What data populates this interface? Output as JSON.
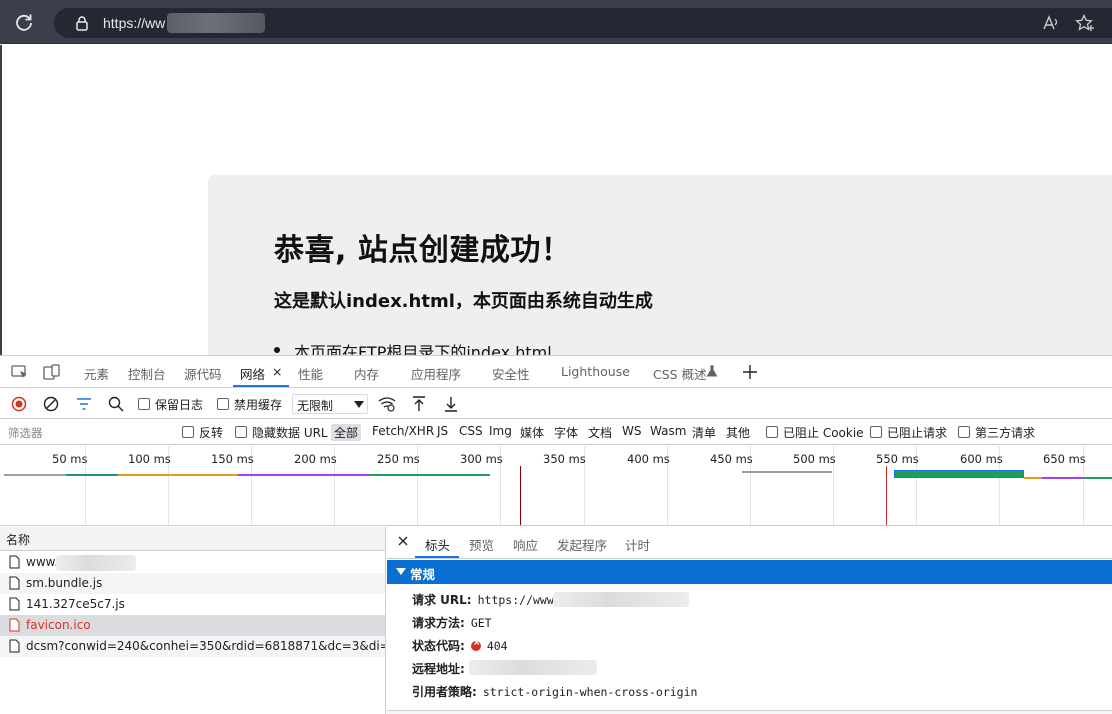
{
  "browser": {
    "url_prefix": "https://ww"
  },
  "page": {
    "title": "恭喜, 站点创建成功！",
    "subtitle": "这是默认index.html，本页面由系统自动生成",
    "bullets": [
      "本页面在FTP根目录下的index.html"
    ]
  },
  "devtools": {
    "tabs": [
      {
        "label": "元素"
      },
      {
        "label": "控制台"
      },
      {
        "label": "源代码"
      },
      {
        "label": "网络",
        "active": true
      },
      {
        "label": "性能"
      },
      {
        "label": "内存"
      },
      {
        "label": "应用程序"
      },
      {
        "label": "安全性"
      },
      {
        "label": "Lighthouse"
      },
      {
        "label": "CSS 概述"
      }
    ],
    "toolbar": {
      "preserve_log": "保留日志",
      "disable_cache": "禁用缓存",
      "throttle_value": "无限制"
    },
    "filter": {
      "placeholder": "筛选器",
      "invert": "反转",
      "hide_data_urls": "隐藏数据 URL",
      "types": [
        "全部",
        "Fetch/XHR",
        "JS",
        "CSS",
        "Img",
        "媒体",
        "字体",
        "文档",
        "WS",
        "Wasm",
        "清单",
        "其他"
      ],
      "blocked_cookies": "已阻止 Cookie",
      "blocked_requests": "已阻止请求",
      "third_party": "第三方请求"
    },
    "timeline": {
      "ticks": [
        "50 ms",
        "100 ms",
        "150 ms",
        "200 ms",
        "250 ms",
        "300 ms",
        "350 ms",
        "400 ms",
        "450 ms",
        "500 ms",
        "550 ms",
        "600 ms",
        "650 ms"
      ]
    },
    "requests": {
      "header": "名称",
      "rows": [
        {
          "name": "www.",
          "blurred": true
        },
        {
          "name": "sm.bundle.js"
        },
        {
          "name": "141.327ce5c7.js"
        },
        {
          "name": "favicon.ico",
          "error": true,
          "selected": true
        },
        {
          "name": "dcsm?conwid=240&conhei=350&rdid=6818871&dc=3&di=u681..."
        }
      ]
    },
    "detail": {
      "tabs": [
        "标头",
        "预览",
        "响应",
        "发起程序",
        "计时"
      ],
      "section_title": "常规",
      "fields": {
        "request_url_label": "请求 URL:",
        "request_url_value": "https://www.",
        "method_label": "请求方法:",
        "method_value": "GET",
        "status_label": "状态代码:",
        "status_value": "404",
        "remote_label": "远程地址:",
        "referrer_label": "引用者策略:",
        "referrer_value": "strict-origin-when-cross-origin"
      }
    }
  },
  "colors": {
    "accent": "#1a73e8",
    "section_blue": "#0a6fd3",
    "error": "#d93025"
  }
}
